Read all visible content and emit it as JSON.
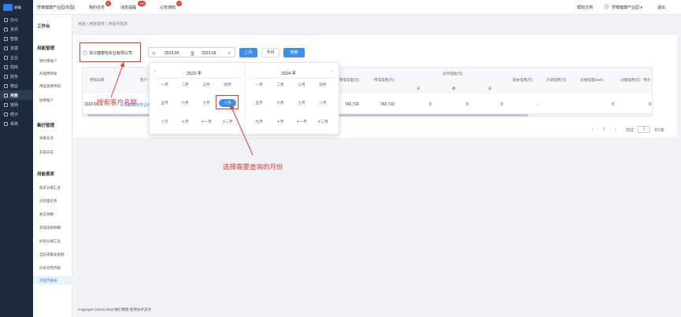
{
  "app": {
    "logo_text": "舒泰",
    "logo_sub": "SHUTAI"
  },
  "topbar": {
    "app_name": "舒泰健康产业园(石园)",
    "tasks_label": "我的任务",
    "tasks_count": "8",
    "messages_label": "消息提醒",
    "messages_count": "116",
    "notices_label": "公告通知",
    "notices_count": "9",
    "help_label": "帮助文档",
    "user_label": "舒泰健康产业园 ▾",
    "logout_label": "退出"
  },
  "sidebar": {
    "items": [
      {
        "label": "办公"
      },
      {
        "label": "资讯"
      },
      {
        "label": "智能"
      },
      {
        "label": "资源"
      },
      {
        "label": "企业"
      },
      {
        "label": "招商"
      },
      {
        "label": "财务"
      },
      {
        "label": "物业"
      },
      {
        "label": "用能"
      },
      {
        "label": "管网"
      },
      {
        "label": "统计"
      },
      {
        "label": "系统"
      }
    ]
  },
  "submenu": {
    "workbench": "工作台",
    "group1": "用能管理",
    "g1_items": [
      {
        "label": "预付费账户"
      },
      {
        "label": "办理费审核"
      },
      {
        "label": "用电退费审核"
      },
      {
        "label": "退费账户"
      }
    ],
    "group2": "集抄管理",
    "g2_items": [
      {
        "label": "采集任务"
      },
      {
        "label": "实采日志"
      }
    ],
    "group3": "用能报表",
    "g3_items": [
      {
        "label": "收支分类汇总"
      },
      {
        "label": "日用量走势"
      },
      {
        "label": "收支明细"
      },
      {
        "label": "充值退款明细"
      },
      {
        "label": "抄表分类汇总"
      },
      {
        "label": "当前采集总金额"
      },
      {
        "label": "抄表日用月报"
      },
      {
        "label": "月度月报表"
      }
    ]
  },
  "breadcrumb": "用能 / 用能报表 / 用能月报表",
  "filter": {
    "customer": "浙江健康怡实业有限公司",
    "date_start": "2023-06",
    "date_sep": "至",
    "date_end": "2023-08",
    "prev_month": "上月",
    "this_month": "今月",
    "search": "搜索"
  },
  "table": {
    "headers": {
      "period": "用电日期",
      "customer": "客户",
      "kwh": "用电电量(元)",
      "amount": "用电电费(元)",
      "split": "分时电量(元)",
      "sharp": "尖",
      "peak": "峰",
      "valley": "谷",
      "basic": "基本电费(元)",
      "power_factor": "力调电费(元)",
      "shared_kwh": "分摊电量(kwh)",
      "shared_fee": "分摊电费(元)",
      "more": "用水"
    },
    "rows": [
      {
        "period": "2023-06",
        "customer": "浙江健康怡实业有限公司",
        "kwh": "742,716",
        "amount": "742,716",
        "sharp": "0",
        "peak": "0",
        "valley": "0",
        "basic": "-",
        "power_factor": "",
        "shared_kwh": "0",
        "shared_fee": "0"
      }
    ]
  },
  "pagination": {
    "prev": "‹",
    "page": "1",
    "next": "›",
    "goto_label": "前往",
    "goto_page": "1",
    "total": "共1条"
  },
  "picker": {
    "left_year": "2023 年",
    "right_year": "2024 年",
    "months_left": [
      "一月",
      "二月",
      "三月",
      "四月",
      "五月",
      "六月",
      "七月",
      "八月",
      "九月",
      "十月",
      "十一月",
      "十二月"
    ],
    "months_right": [
      "一月",
      "二月",
      "三月",
      "四月",
      "五月",
      "六月",
      "七月",
      "八月",
      "九月",
      "十月",
      "十一月",
      "十二月"
    ],
    "selected_month": "八月"
  },
  "annotations": {
    "search_customer": "搜索客户名称",
    "select_month": "选择需要查询的月份"
  },
  "footer": "Copyright ©2015-2020 数们网络 提供技术支持",
  "colors": {
    "accent": "#3a8ff0",
    "sidebar": "#1e2a3d",
    "annotation": "#e53935"
  }
}
